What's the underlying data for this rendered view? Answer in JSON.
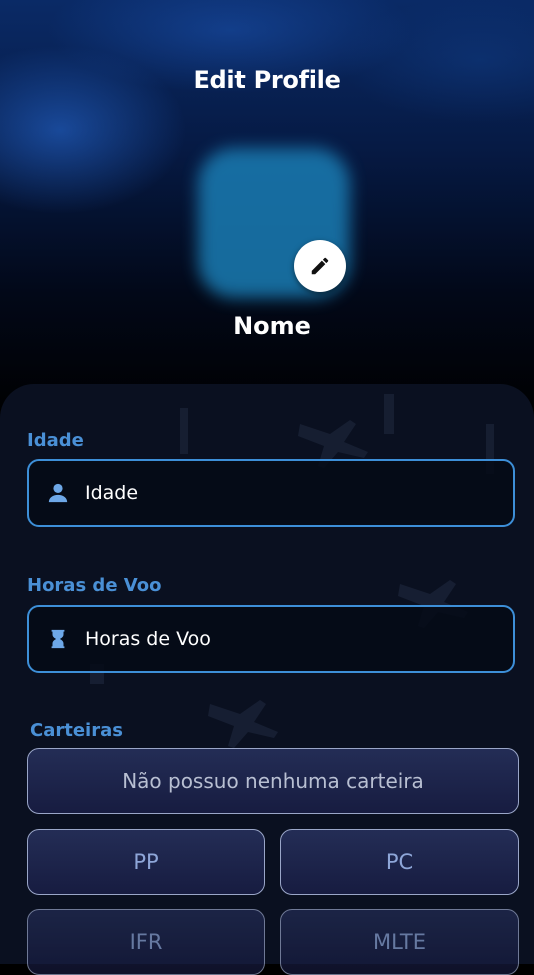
{
  "header": {
    "title": "Edit Profile",
    "name": "Nome"
  },
  "fields": [
    {
      "label": "Idade",
      "placeholder": "Idade",
      "icon": "person-icon"
    },
    {
      "label": "Horas de Voo",
      "placeholder": "Horas de Voo",
      "icon": "hourglass-icon"
    }
  ],
  "licenses": {
    "label": "Carteiras",
    "none_option": "Não possuo nenhuma carteira",
    "options": [
      "PP",
      "PC",
      "IFR",
      "MLTE"
    ]
  },
  "colors": {
    "accent": "#3d8fd8",
    "label": "#4a90d6",
    "option_text": "#8ea6d8"
  }
}
